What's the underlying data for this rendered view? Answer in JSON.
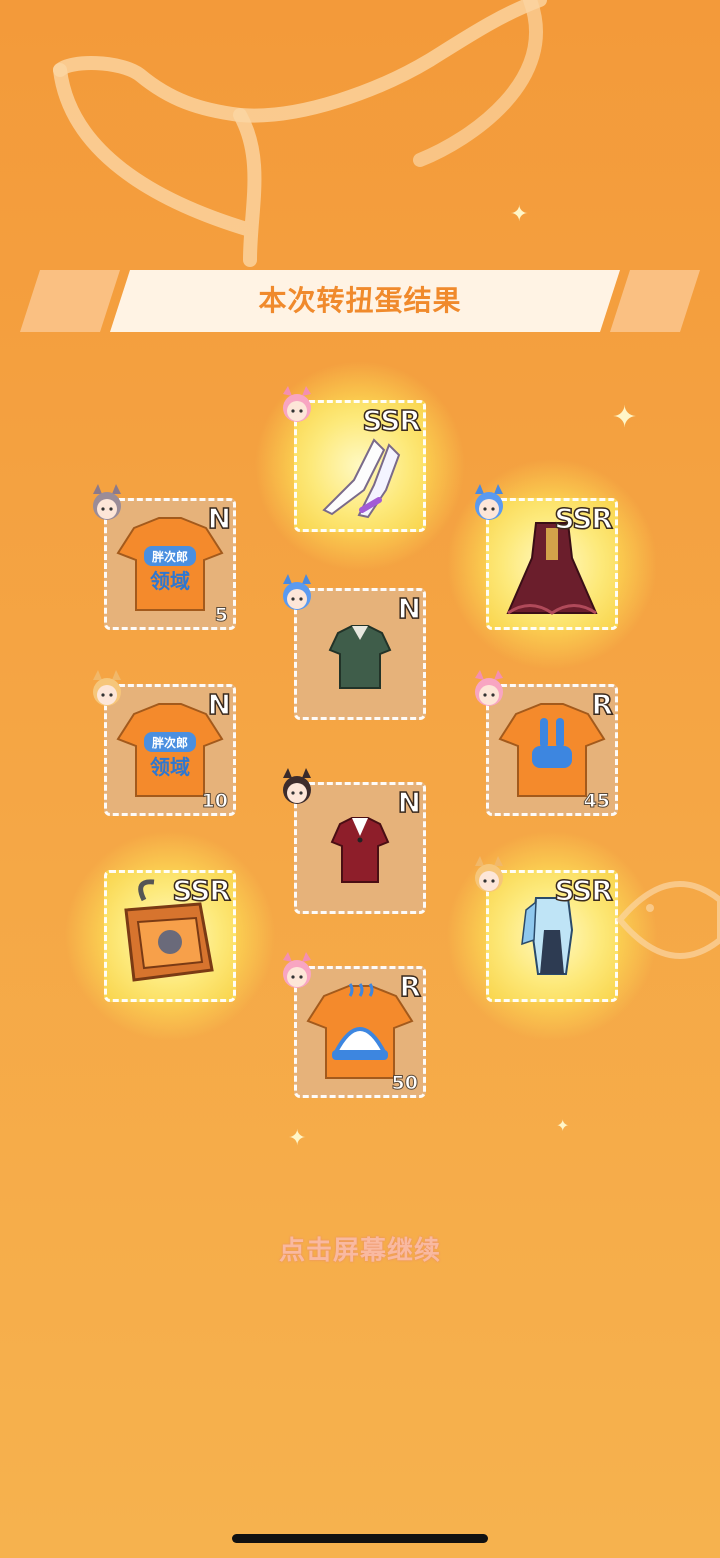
{
  "header": {
    "title": "本次转扭蛋结果"
  },
  "items": [
    {
      "id": "i1",
      "rarity": "SSR",
      "count": "",
      "icon": "stockings-icon",
      "avatar": "pink-cat-girl-avatar"
    },
    {
      "id": "i2",
      "rarity": "N",
      "count": "5",
      "icon": "orange-tshirt-icon",
      "avatar": "gray-hair-girl-avatar"
    },
    {
      "id": "i3",
      "rarity": "SSR",
      "count": "",
      "icon": "gothic-dress-icon",
      "avatar": "blue-cat-girl-avatar"
    },
    {
      "id": "i4",
      "rarity": "N",
      "count": "",
      "icon": "green-top-icon",
      "avatar": "blue-cat-girl-avatar"
    },
    {
      "id": "i5",
      "rarity": "N",
      "count": "10",
      "icon": "orange-tshirt-icon",
      "avatar": "blonde-fox-girl-avatar"
    },
    {
      "id": "i6",
      "rarity": "R",
      "count": "45",
      "icon": "bunny-tshirt-icon",
      "avatar": "pink-cat-girl-avatar"
    },
    {
      "id": "i7",
      "rarity": "N",
      "count": "",
      "icon": "red-jacket-icon",
      "avatar": "dark-hair-girl-avatar"
    },
    {
      "id": "i8",
      "rarity": "SSR",
      "count": "",
      "icon": "treasure-chest-icon",
      "avatar": ""
    },
    {
      "id": "i9",
      "rarity": "SSR",
      "count": "",
      "icon": "blue-outfit-icon",
      "avatar": "blonde-fox-girl-avatar"
    },
    {
      "id": "i10",
      "rarity": "R",
      "count": "50",
      "icon": "cat-tshirt-icon",
      "avatar": "pink-cat-girl-avatar"
    }
  ],
  "tshirt_text": "胖次郎\n领域",
  "footer": {
    "continue_label": "点击屏幕继续"
  },
  "colors": {
    "background": "#f5a544",
    "title": "#f08a2c",
    "ssr_glow": "#fde97a",
    "card": "#e6b27a"
  }
}
